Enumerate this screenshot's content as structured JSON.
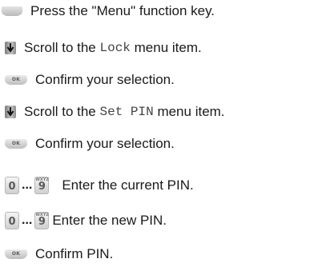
{
  "steps": [
    {
      "icon": "function-key-icon",
      "pre": "Press the \"Menu\" function key.",
      "code": "",
      "post": ""
    },
    {
      "icon": "scroll-icon",
      "pre": "Scroll to the ",
      "code": "Lock",
      "post": " menu item."
    },
    {
      "icon": "ok-key-icon",
      "pre": "Confirm your selection.",
      "code": "",
      "post": ""
    },
    {
      "icon": "scroll-icon",
      "pre": "Scroll to the ",
      "code": "Set PIN",
      "post": " menu item."
    },
    {
      "icon": "ok-key-icon",
      "pre": "Confirm your selection.",
      "code": "",
      "post": ""
    },
    {
      "icon": "digit-keys-icon",
      "pre": "Enter the current PIN.",
      "code": "",
      "post": ""
    },
    {
      "icon": "digit-keys-icon",
      "pre": "Enter the new PIN.",
      "code": "",
      "post": ""
    },
    {
      "icon": "ok-key-icon",
      "pre": "Confirm PIN.",
      "code": "",
      "post": ""
    }
  ],
  "keys": {
    "ok_label": "OK",
    "digit_start": "0",
    "digit_end": "9",
    "digit_end_letters": "WXYZ",
    "range_dots": "..."
  }
}
